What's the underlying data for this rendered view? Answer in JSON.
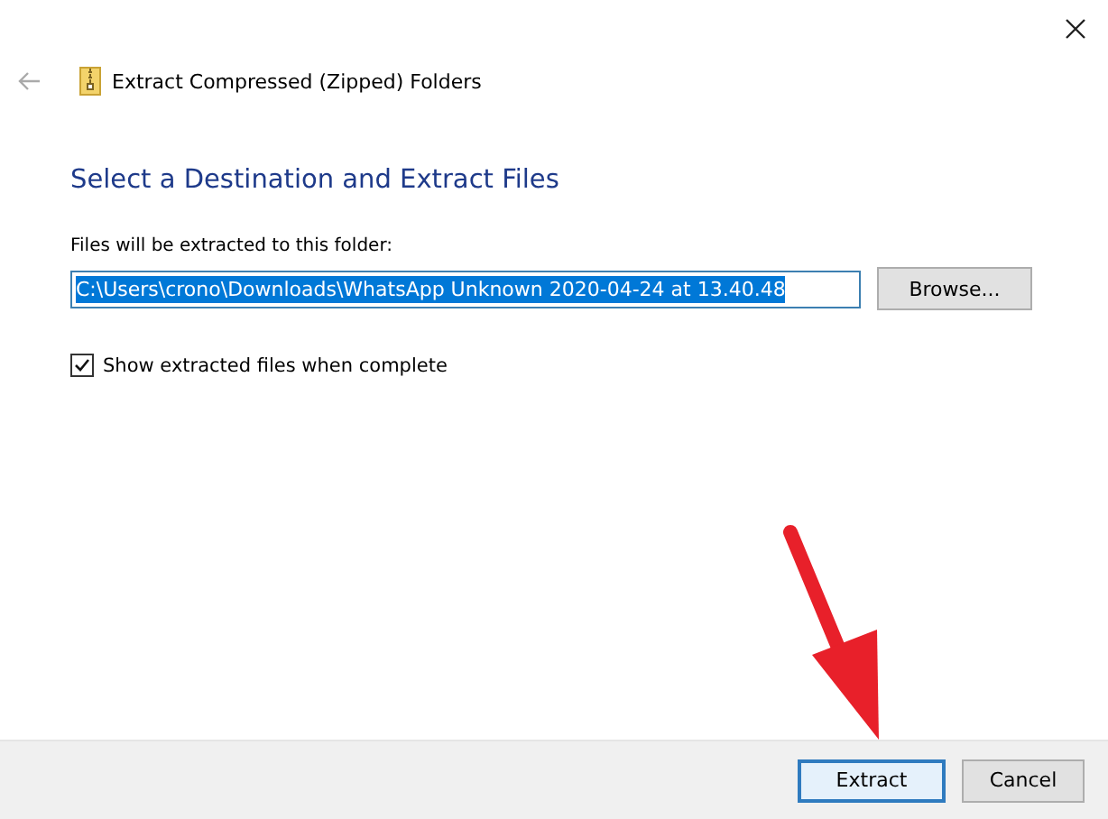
{
  "window": {
    "title": "Extract Compressed (Zipped) Folders"
  },
  "heading": "Select a Destination and Extract Files",
  "destination": {
    "label": "Files will be extracted to this folder:",
    "value": "C:\\Users\\crono\\Downloads\\WhatsApp Unknown 2020-04-24 at 13.40.48",
    "text_selected": true
  },
  "browse_button": "Browse...",
  "show_files": {
    "label": "Show extracted files when complete",
    "checked": true
  },
  "buttons": [
    {
      "label": "Extract",
      "default": true
    },
    {
      "label": "Cancel",
      "default": false
    }
  ]
}
